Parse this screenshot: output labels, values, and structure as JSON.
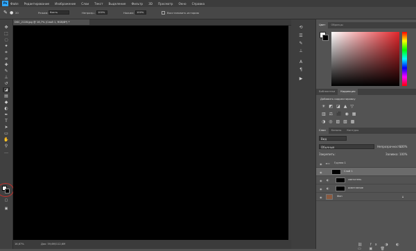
{
  "app": {
    "logo": "Ps",
    "accent": "#31a8ff"
  },
  "menu": [
    "Файл",
    "Редактирование",
    "Изображение",
    "Слои",
    "Текст",
    "Выделение",
    "Фильтр",
    "3D",
    "Просмотр",
    "Окно",
    "Справка"
  ],
  "options": {
    "size": "20",
    "mode_label": "Режим:",
    "mode_value": "Кисть",
    "opacity_label": "Непрозр.:",
    "opacity_value": "100%",
    "flow_label": "Нажим:",
    "flow_value": "100%",
    "history_button": "Восстановить историю"
  },
  "document": {
    "tab_title": "DSC_2128.jpg @ 16,7% (Слой 1, RGB/8*) *",
    "status_zoom": "16,67%",
    "status_doc": "Док: 59,6М/112,6М"
  },
  "color_panel": {
    "tabs": [
      "Цвет",
      "Образцы"
    ],
    "active": 0
  },
  "adjust_panel": {
    "tabs": [
      "Библиотеки",
      "Коррекция"
    ],
    "active": 1,
    "title": "Добавить корректировку"
  },
  "layers_panel": {
    "tabs": [
      "Слои",
      "Каналы",
      "Контуры"
    ],
    "active": 0,
    "filter_label": "Вид",
    "blend_mode": "Обычные",
    "opacity_label": "Непрозрачность:",
    "opacity_value": "100%",
    "lock_label": "Закрепить:",
    "fill_label": "Заливка:",
    "fill_value": "100%",
    "layers": [
      {
        "name": "Группа 1",
        "type": "group"
      },
      {
        "name": "Слой 1",
        "type": "black"
      },
      {
        "name": "светотень",
        "type": "mask"
      },
      {
        "name": "осветление",
        "type": "mask"
      },
      {
        "name": "Фон",
        "type": "photo"
      }
    ]
  }
}
